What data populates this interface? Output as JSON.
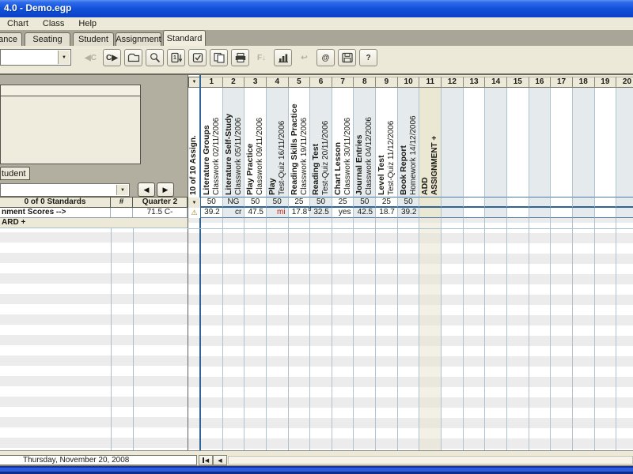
{
  "window": {
    "title": "4.0 - Demo.egp"
  },
  "menubar": {
    "items": [
      {
        "label": "Chart"
      },
      {
        "label": "Class"
      },
      {
        "label": "Help"
      }
    ]
  },
  "tabs": [
    {
      "label": "dance"
    },
    {
      "label": "Seating"
    },
    {
      "label": "Student"
    },
    {
      "label": "Assignment"
    },
    {
      "label": "Standard",
      "cls": "active"
    }
  ],
  "toolbar": {
    "buttons": [
      {
        "name": "class-back",
        "glyph": "◀C",
        "disabled": true
      },
      {
        "name": "class-forward",
        "glyph": "C▶",
        "disabled": false
      },
      {
        "name": "open-folder",
        "icon": "folder-icon"
      },
      {
        "name": "find",
        "icon": "magnifier-icon"
      },
      {
        "name": "sort",
        "icon": "sort-icon"
      },
      {
        "name": "checklist",
        "icon": "checkbox-icon"
      },
      {
        "name": "copy-records",
        "icon": "copy-icon"
      },
      {
        "name": "print",
        "icon": "printer-icon"
      },
      {
        "name": "footnote",
        "glyph": "F↓",
        "disabled": true
      },
      {
        "name": "chart",
        "icon": "bar-chart-icon"
      },
      {
        "name": "undo",
        "glyph": "↩",
        "disabled": true
      },
      {
        "name": "email",
        "glyph": "@",
        "disabled": false
      },
      {
        "name": "save",
        "icon": "disk-icon"
      },
      {
        "name": "help",
        "glyph": "?",
        "disabled": false
      }
    ]
  },
  "icons": {
    "dropdown": "▼",
    "warning": "⚠",
    "prev": "◀",
    "next": "▶",
    "scroll_left": "◀"
  },
  "left_panel": {
    "tab_label": "tudent"
  },
  "grid": {
    "assign_count_label": "10 of 10 Assign.",
    "columns": [
      {
        "num": "1",
        "name": "Literature Groups",
        "detail": "Classwork 02/11/2006",
        "max": "50",
        "score": "39.2"
      },
      {
        "num": "2",
        "name": "Literature Self-Study",
        "detail": "Classwork 05/11/2006",
        "max": "NG",
        "score": "cr"
      },
      {
        "num": "3",
        "name": "Play Practice",
        "detail": "Classwork 09/11/2006",
        "max": "50",
        "score": "47.5"
      },
      {
        "num": "4",
        "name": "Play",
        "detail": "Test-Quiz 16/11/2006",
        "max": "50",
        "score": "mi",
        "cls": "mi"
      },
      {
        "num": "5",
        "name": "Reading Skills Practice",
        "detail": "Classwork 19/11/2006",
        "max": "25",
        "score": "17.8",
        "footnote": "d"
      },
      {
        "num": "6",
        "name": "Reading Test",
        "detail": "Test-Quiz 20/11/2006",
        "max": "50",
        "score": "32.5"
      },
      {
        "num": "7",
        "name": "Chart Lesson",
        "detail": "Classwork 30/11/2006",
        "max": "25",
        "score": "yes"
      },
      {
        "num": "8",
        "name": "Journal Entries",
        "detail": "Classwork 04/12/2006",
        "max": "50",
        "score": "42.5"
      },
      {
        "num": "9",
        "name": "Level Test",
        "detail": "Test-Quiz 11/12/2006",
        "max": "25",
        "score": "18.7"
      },
      {
        "num": "10",
        "name": "Book Report",
        "detail": "Homework 14/12/2006",
        "max": "50",
        "score": "39.2"
      },
      {
        "num": "11",
        "name": "ADD",
        "detail": "ASSIGNMENT +"
      },
      {
        "num": "12"
      },
      {
        "num": "13"
      },
      {
        "num": "14"
      },
      {
        "num": "15"
      },
      {
        "num": "16"
      },
      {
        "num": "17"
      },
      {
        "num": "18"
      },
      {
        "num": "19"
      },
      {
        "num": "20"
      }
    ],
    "standards": {
      "header": {
        "title": "0 of 0 Standards",
        "num_col": "#",
        "term_col": "Quarter 2"
      },
      "score_row": {
        "label": "nment Scores --&gt;",
        "label_plain": "nment Scores -->",
        "grade": "71.5 C-"
      },
      "add_row": {
        "label": "ARD +"
      }
    }
  },
  "status_bar": {
    "date": "Thursday, November 20, 2008"
  }
}
